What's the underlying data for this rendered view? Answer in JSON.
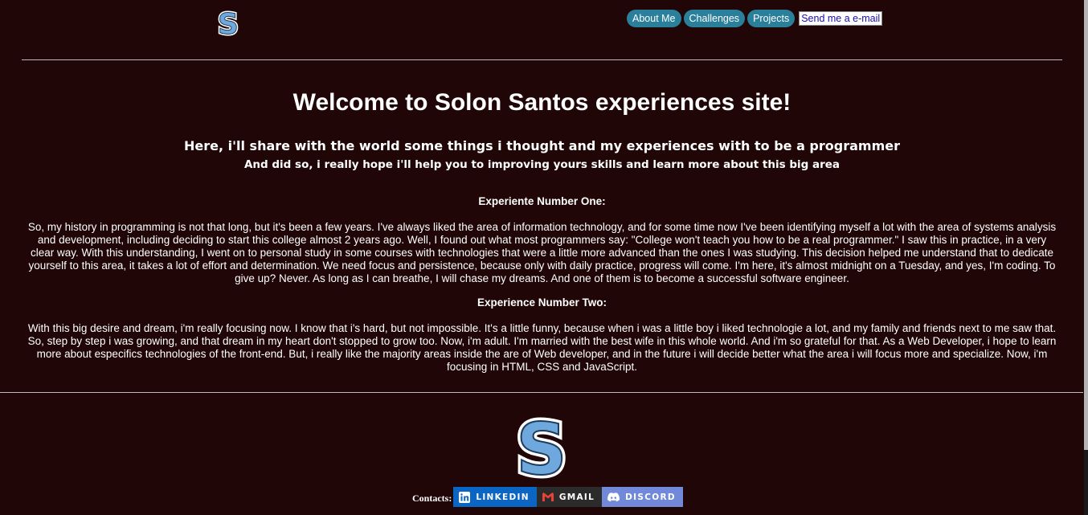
{
  "header": {
    "logo_icon": "s-letter-logo-icon",
    "nav": [
      {
        "label": "About Me"
      },
      {
        "label": "Challenges"
      },
      {
        "label": "Projects"
      }
    ],
    "mail_link": "Send me a e-mail"
  },
  "main": {
    "title": "Welcome to Solon Santos experiences site!",
    "subtitle": "Here, i'll share with the world some things i thought and my experiences with to be a programmer",
    "subtitle2": "And did so, i really hope i'll help you to improving yours skills and learn more about this big area",
    "experiences": [
      {
        "title": "Experiente Number One:",
        "text": "So, my history in programming is not that long, but it's been a few years. I've always liked the area of information technology, and for some time now I've been identifying myself a lot with the area of systems analysis and development, including deciding to start this college almost 2 years ago. Well, I found out what most programmers say: \"College won't teach you how to be a real programmer.\" I saw this in practice, in a very clear way. With this understanding, I went on to personal study in some courses with technologies that were a little more advanced than the ones I was studying. This decision helped me understand that to dedicate yourself to this area, it takes a lot of effort and determination. We need focus and persistence, because only with daily practice, progress will come. I'm here, it's almost midnight on a Tuesday, and yes, I'm coding. To give up? Never. As long as I can breathe, I will chase my dreams. And one of them is to become a successful software engineer."
      },
      {
        "title": "Experience Number Two:",
        "text": "With this big desire and dream, i'm really focusing now. I know that i's hard, but not impossible. It's a little funny, because when i was a little boy i liked technologie a lot, and my family and friends next to me saw that. So, step by step i was growing, and that dream in my heart don't stopped to grow too. Now, i'm adult. I'm married with the best wife in this whole world. And i'm so grateful for that. As a Web Developer, i hope to learn more about especifics technologies of the front-end. But, i really like the majority areas inside the are of Web developer, and in the future i will decide better what the area i will focus more and specialize. Now, i'm focusing in HTML, CSS and JavaScript."
      }
    ]
  },
  "footer": {
    "logo_icon": "s-letter-logo-icon",
    "contacts_label": "Contacts:",
    "badges": [
      {
        "label": "LINKEDIN",
        "icon": "linkedin-icon",
        "color": "#0a66c2"
      },
      {
        "label": "GMAIL",
        "icon": "gmail-icon",
        "color": "#2b2b2b"
      },
      {
        "label": "DISCORD",
        "icon": "discord-icon",
        "color": "#7289da"
      }
    ]
  },
  "colors": {
    "background": "#200606",
    "nav_button": "#2a7f9a",
    "logo_fill": "#6fa8dc"
  }
}
